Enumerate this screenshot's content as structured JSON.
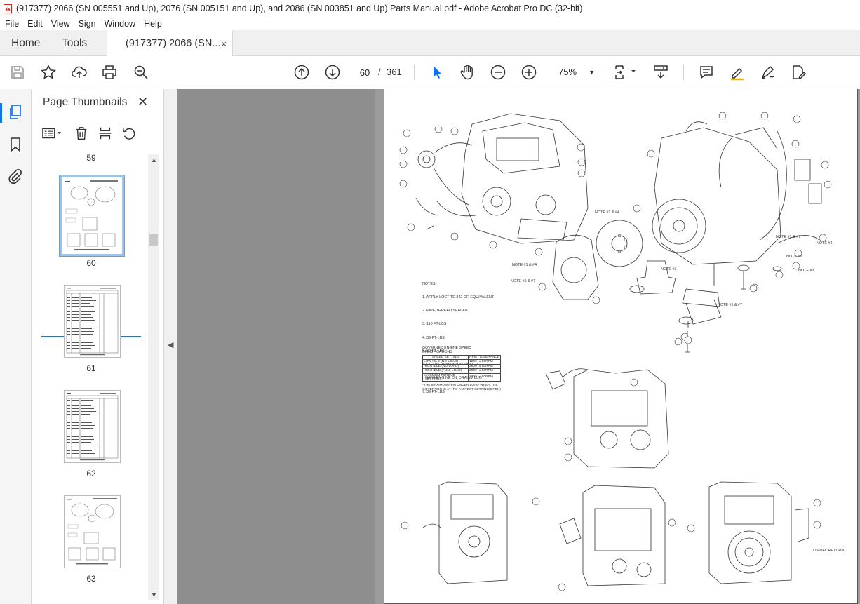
{
  "window": {
    "title": "(917377) 2066 (SN 005551 and Up), 2076 (SN 005151 and Up), and 2086 (SN 003851 and Up) Parts Manual.pdf - Adobe Acrobat Pro DC (32-bit)"
  },
  "menu": [
    "File",
    "Edit",
    "View",
    "Sign",
    "Window",
    "Help"
  ],
  "tabs": {
    "home": "Home",
    "tools": "Tools",
    "doc": "(917377) 2066 (SN...",
    "doc_close": "×"
  },
  "toolbar": {
    "current_page": "60",
    "page_separator": "/",
    "total_pages": "361",
    "zoom": "75%"
  },
  "thumbnails_panel": {
    "title": "Page Thumbnails",
    "close": "✕",
    "labels": [
      "59",
      "60",
      "61",
      "62",
      "63"
    ],
    "selected": "60"
  },
  "document": {
    "notes": [
      "NOTES:",
      "1. APPLY LOCTITE 242 OR EQUIVALENT",
      "2. PIPE THREAD SEALANT",
      "3. 110 FT-LBS",
      "4. 39 FT-LBS",
      "5. 39 FT-LBS",
      "6. RE-USE WASHER SUPPLIED",
      "   WITH ENGINE OIL DRAIN PLUG",
      "7. 39 FT-LBS"
    ],
    "spec_table": {
      "caption": "GOVERNED ENGINE SPEED SPECIFICATIONS",
      "headers": [
        "SPEED SETTING",
        "RPM",
        "TOLERANCE"
      ],
      "rows": [
        [
          "LOW IDLE (NO LOAD)",
          "1200",
          "± 50RPM"
        ],
        [
          "HIGH IDLE (NO LOAD)",
          "2600",
          "± 50RPM"
        ],
        [
          "HIGH IDLE (FULL LOAD)",
          "2500",
          "± 50RPM"
        ],
        [
          "MAXIMUM TORQUE (SETTING)",
          "2300",
          "± 50RPM"
        ]
      ],
      "footnote": [
        "*THE MAXIMUM RPM UNDER LOAD WHEN THE",
        "GOVERNOR IS AT IT'S FASTEST SETTING(OPEN)"
      ]
    },
    "note_labels": [
      "NOTE #1 & #4",
      "NOTE #1 & #4",
      "NOTE #1 & #7",
      "NOTE #3",
      "NOTE #1 & #7",
      "NOTE #1 & #7",
      "NOTE #2",
      "NOTE #2",
      "NOTE #3"
    ],
    "fuel_return": "TO FUEL RETURN"
  }
}
